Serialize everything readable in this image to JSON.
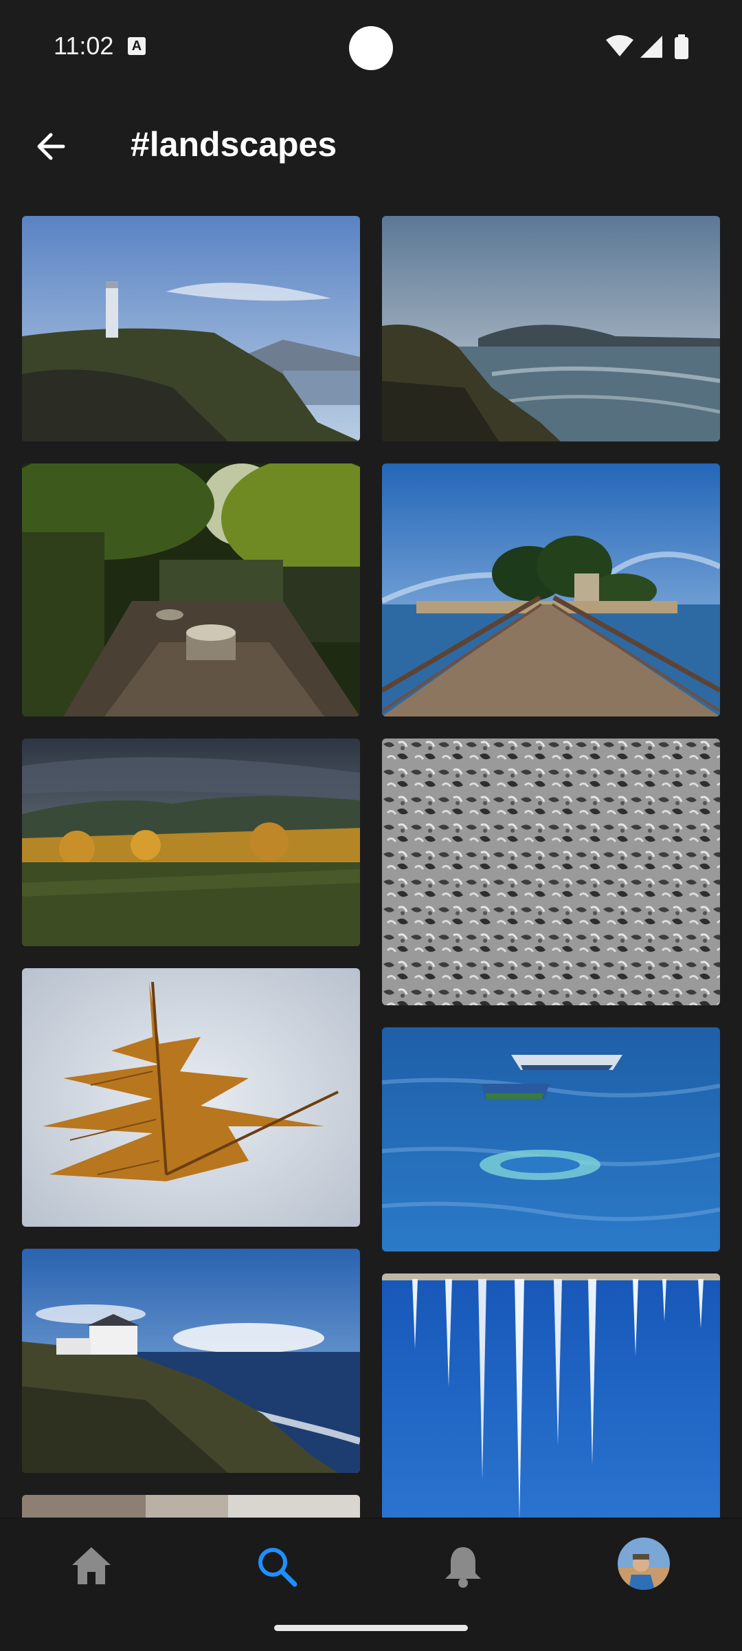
{
  "status_bar": {
    "time": "11:02",
    "badge": "A"
  },
  "app_bar": {
    "title": "#landscapes"
  },
  "colors": {
    "accent": "#1e90ff",
    "background": "#1c1c1d"
  },
  "photos": [
    "lighthouse-on-coast",
    "rocky-coastline-sea",
    "mossy-stone-ruins-forest",
    "wooden-bridge-to-island",
    "autumn-mountain-field",
    "gray-abstract-texture",
    "oak-leaf-on-ice",
    "blue-water-boats",
    "white-house-on-cliff",
    "icicles-blue-sky",
    "partial-photo"
  ],
  "nav": {
    "home": "home-icon",
    "search": "search-icon",
    "notifications": "bell-icon",
    "profile": "avatar"
  }
}
